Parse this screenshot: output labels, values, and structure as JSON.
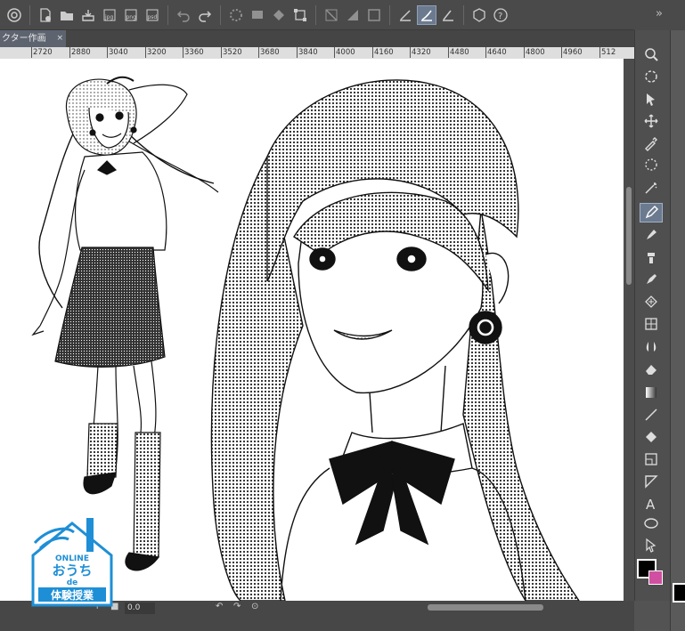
{
  "toolbar": {
    "buttons": [
      "clip-studio-icon",
      "new-file-icon",
      "open-file-icon",
      "save-icon",
      "export-jpg-icon",
      "export-png-icon",
      "export-psd-icon",
      "undo-icon",
      "redo-icon",
      "loading-icon",
      "fill-selection-icon",
      "clear-icon",
      "transform-icon",
      "snap-off-icon",
      "snap-ruler-icon",
      "snap-grid-icon",
      "pen-pressure-icon",
      "stroke-icon",
      "special-ruler-icon",
      "3d-icon",
      "help-icon"
    ],
    "labels": {
      "jpg": "jpg",
      "png": "png",
      "psd": "psd"
    }
  },
  "tab": {
    "title": "クター作画",
    "close": "×"
  },
  "ruler": {
    "ticks": [
      "2720",
      "2880",
      "3040",
      "3200",
      "3360",
      "3520",
      "3680",
      "3840",
      "4000",
      "4160",
      "4320",
      "4480",
      "4640",
      "4800",
      "4960",
      "512"
    ]
  },
  "status": {
    "zoom": "0.0"
  },
  "right_panel": {
    "collapse": "»"
  },
  "tools": [
    "zoom-icon",
    "rotate-icon",
    "object-icon",
    "move-icon",
    "eyedropper-icon",
    "lasso-icon",
    "magic-wand-icon",
    "pen-icon",
    "pencil-icon",
    "brush-icon",
    "airbrush-icon",
    "decoration-icon",
    "blend-icon",
    "eraser-icon",
    "gradient-icon",
    "line-icon",
    "fill-icon",
    "frame-icon",
    "ruler-icon",
    "text-icon",
    "balloon-icon",
    "correct-line-icon"
  ],
  "colors": {
    "main": "#000000",
    "sub": "#d04fa0",
    "accent": "#6c7a8f"
  },
  "logo": {
    "line1": "ONLINE",
    "line2": "おうち",
    "line3": "de",
    "line4": "体験授業"
  }
}
